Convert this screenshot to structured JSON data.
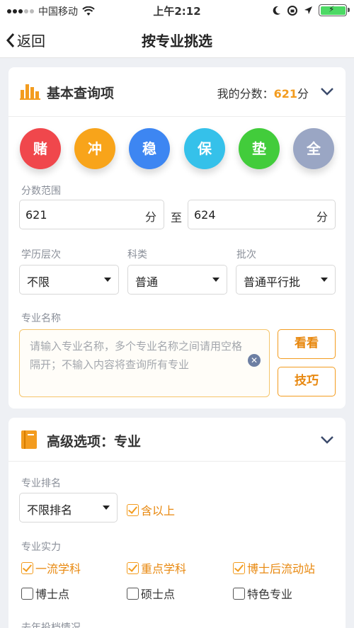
{
  "status": {
    "carrier": "中国移动",
    "time": "上午2:12"
  },
  "nav": {
    "back_label": "返回",
    "title": "按专业挑选"
  },
  "basic": {
    "title": "基本查询项",
    "score_label": "我的分数：",
    "score_value": "621",
    "score_unit": "分",
    "buttons": [
      {
        "label": "赌",
        "color": "#f0474c"
      },
      {
        "label": "冲",
        "color": "#f8a41a"
      },
      {
        "label": "稳",
        "color": "#3d86f2"
      },
      {
        "label": "保",
        "color": "#35c1ea"
      },
      {
        "label": "垫",
        "color": "#42cc3b"
      },
      {
        "label": "全",
        "color": "#9aa6c4"
      }
    ],
    "range_label": "分数范围",
    "range_from": "621",
    "range_to": "624",
    "unit": "分",
    "to_label": "至",
    "education_label": "学历层次",
    "education_value": "不限",
    "subject_label": "科类",
    "subject_value": "普通",
    "batch_label": "批次",
    "batch_value": "普通平行批",
    "major_label": "专业名称",
    "major_placeholder": "请输入专业名称，多个专业名称之间请用空格隔开；不输入内容将查询所有专业",
    "look_button": "看看",
    "tips_button": "技巧"
  },
  "advanced": {
    "title": "高级选项：专业",
    "rank_label": "专业排名",
    "rank_value": "不限排名",
    "include_above": "含以上",
    "strength_label": "专业实力",
    "options": [
      {
        "label": "一流学科",
        "checked": true
      },
      {
        "label": "重点学科",
        "checked": true
      },
      {
        "label": "博士后流动站",
        "checked": true
      },
      {
        "label": "博士点",
        "checked": false
      },
      {
        "label": "硕士点",
        "checked": false
      },
      {
        "label": "特色专业",
        "checked": false
      }
    ],
    "last_year_label": "去年投档情况"
  },
  "colors": {
    "accent": "#f39c1f",
    "chevron": "#3b4a6b"
  }
}
